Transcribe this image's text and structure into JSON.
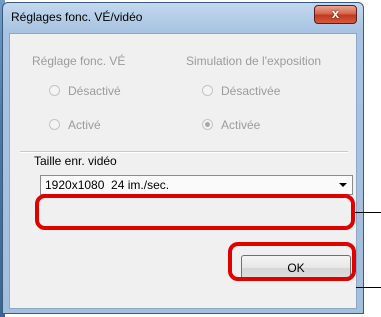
{
  "dialog": {
    "title": "Réglages fonc. VÉ/vidéo",
    "close_icon": "close-icon",
    "close_glyph": "x"
  },
  "groups": {
    "ve_settings": {
      "label": "Réglage fonc. VÉ",
      "options": [
        {
          "label": "Désactivé",
          "selected": false
        },
        {
          "label": "Activé",
          "selected": false
        }
      ]
    },
    "exposure_sim": {
      "label": "Simulation de l'exposition",
      "options": [
        {
          "label": "Désactivée",
          "selected": false
        },
        {
          "label": "Activée",
          "selected": true
        }
      ]
    }
  },
  "video": {
    "size_label": "Taille enr. vidéo",
    "size_value": "1920x1080  24 im./sec.",
    "dropdown_icon": "chevron-down-icon"
  },
  "buttons": {
    "ok_label": "OK"
  },
  "colors": {
    "highlight": "#e00000",
    "close_button": "#c03a1f",
    "disabled_text": "#9b9b9b"
  }
}
